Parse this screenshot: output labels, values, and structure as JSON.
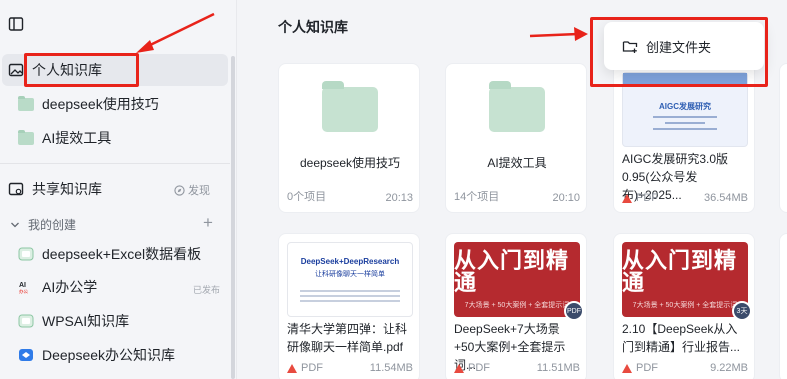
{
  "sidebar": {
    "personal_kb_label": "个人知识库",
    "folders": [
      "deepseek使用技巧",
      "AI提效工具"
    ],
    "shared_kb_label": "共享知识库",
    "discover_label": "发现",
    "my_created_label": "我的创建",
    "kbs": [
      {
        "label": "deepseek+Excel数据看板",
        "icon": "kb-green-icon"
      },
      {
        "label": "AI办公学",
        "icon": "ai-logo-icon",
        "badge": "已发布"
      },
      {
        "label": "WPSAI知识库",
        "icon": "kb-green-icon"
      },
      {
        "label": "Deepseek办公知识库",
        "icon": "kb-blue-icon"
      }
    ]
  },
  "main": {
    "title": "个人知识库",
    "popup_label": "创建文件夹",
    "cards": [
      {
        "name": "deepseek使用技巧",
        "meta_left": "0个项目",
        "meta_right": "20:13"
      },
      {
        "name": "AI提效工具",
        "meta_left": "14个项目",
        "meta_right": "20:10"
      },
      {
        "title": "AIGC发展研究3.0版0.95(公众号发布)+2025...",
        "type": "PDF",
        "size": "36.54MB",
        "thumb_text": "AIGC发展研究"
      },
      {
        "title": "清华大学第四弹：让科研像聊天一样简单.pdf",
        "type": "PDF",
        "size": "11.54MB",
        "thumb_title": "DeepSeek+DeepResearch",
        "thumb_sub": "让科研像聊天一样简单"
      },
      {
        "title": "DeepSeek+7大场景+50大案例+全套提示词...",
        "type": "PDF",
        "size": "11.51MB",
        "thumb_title": "从入门到精通",
        "thumb_sub": "7大场景 + 50大案例 + 全套提示词",
        "badge": "PDF"
      },
      {
        "title": "2.10【DeepSeek从入门到精通】行业报告...",
        "type": "PDF",
        "size": "9.22MB",
        "thumb_title": "从入门到精通",
        "thumb_sub": "7大场景 + 50大案例 + 全套提示词",
        "badge": "3天"
      }
    ]
  },
  "colors": {
    "annotation_red": "#e8231a",
    "folder_green": "#c6e2d1",
    "pdf_red": "#e84a3f"
  }
}
